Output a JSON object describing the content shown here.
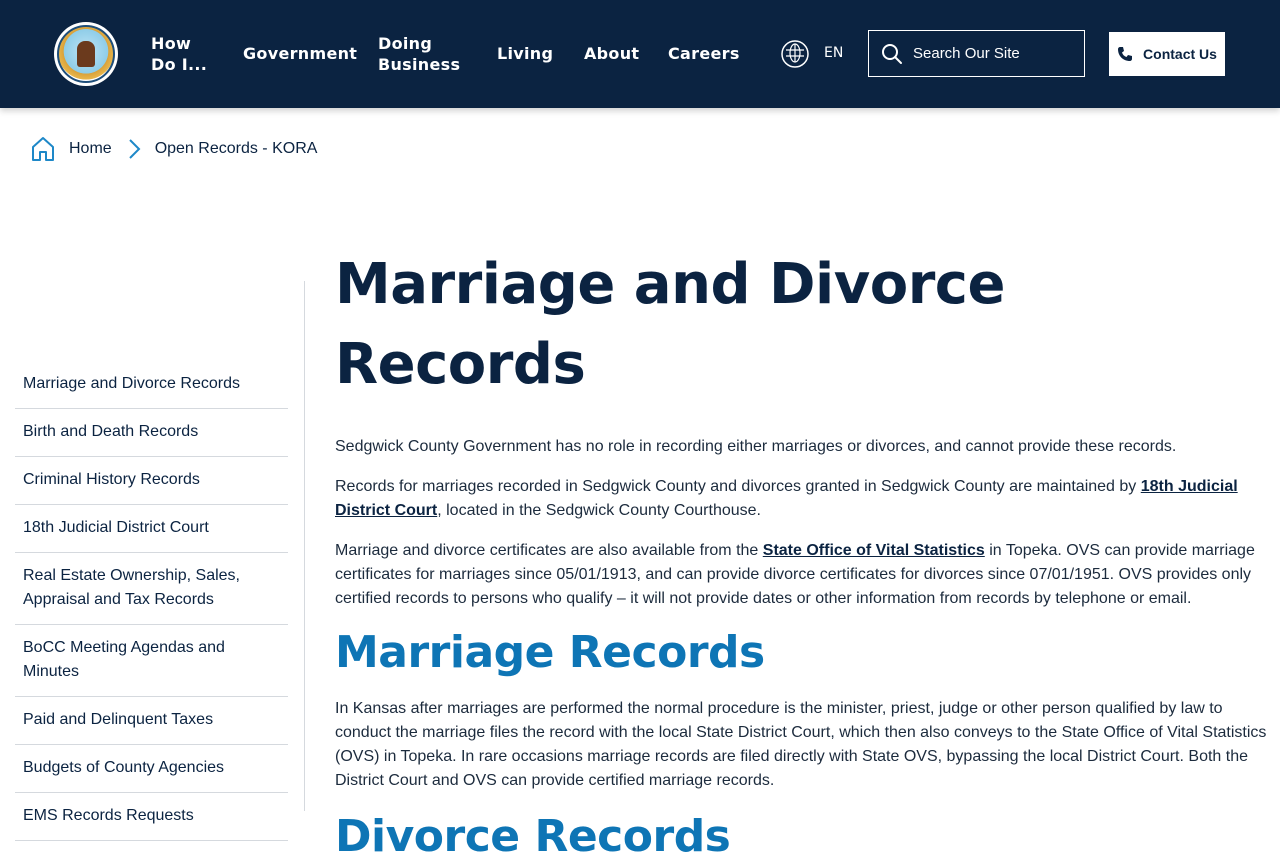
{
  "header": {
    "nav": [
      {
        "label": "How Do I..."
      },
      {
        "label": "Government"
      },
      {
        "label": "Doing Business"
      },
      {
        "label": "Living"
      },
      {
        "label": "About"
      },
      {
        "label": "Careers"
      }
    ],
    "language": "EN",
    "search_placeholder": "Search Our Site",
    "contact_label": "Contact Us",
    "seal_text": "SEDGWICK COUNTY KANSAS"
  },
  "breadcrumb": {
    "home": "Home",
    "current": "Open Records - KORA"
  },
  "sidebar": {
    "items": [
      "Marriage and Divorce Records",
      "Birth and Death Records",
      "Criminal History Records",
      "18th Judicial District Court",
      "Real Estate Ownership, Sales, Appraisal and Tax Records",
      "BoCC Meeting Agendas and Minutes",
      "Paid and Delinquent Taxes",
      "Budgets of County Agencies",
      "EMS Records Requests"
    ]
  },
  "main": {
    "title": "Marriage and Divorce Records",
    "p1": "Sedgwick County Government has no role in recording either marriages or divorces, and cannot provide these records.",
    "p2_before": "Records for marriages recorded in Sedgwick County and divorces granted in Sedgwick County are maintained by ",
    "p2_link": "18th Judicial District Court",
    "p2_after": ", located in the Sedgwick County Courthouse.",
    "p3_before": "Marriage and divorce certificates are also available from the ",
    "p3_link": "State Office of Vital Statistics",
    "p3_after": " in Topeka. OVS can provide marriage certificates for marriages since 05/01/1913, and can provide divorce certificates for divorces since 07/01/1951. OVS provides only certified records to persons who qualify – it will not provide dates or other information from records by telephone or email.",
    "h_marriage": "Marriage Records",
    "p4": "In Kansas after marriages are performed the normal procedure is the minister, priest, judge or other person qualified by law to conduct the marriage files the record with the local State District Court, which then also conveys to the State Office of Vital Statistics (OVS) in Topeka. In rare occasions marriage records are filed directly with State OVS, bypassing the local District Court. Both the District Court and OVS can provide certified marriage records.",
    "h_divorce": "Divorce Records"
  },
  "colors": {
    "header_bg": "#0b2341",
    "heading_dark": "#0b2341",
    "heading_blue": "#0e75b5",
    "divider": "#d5d9de"
  }
}
